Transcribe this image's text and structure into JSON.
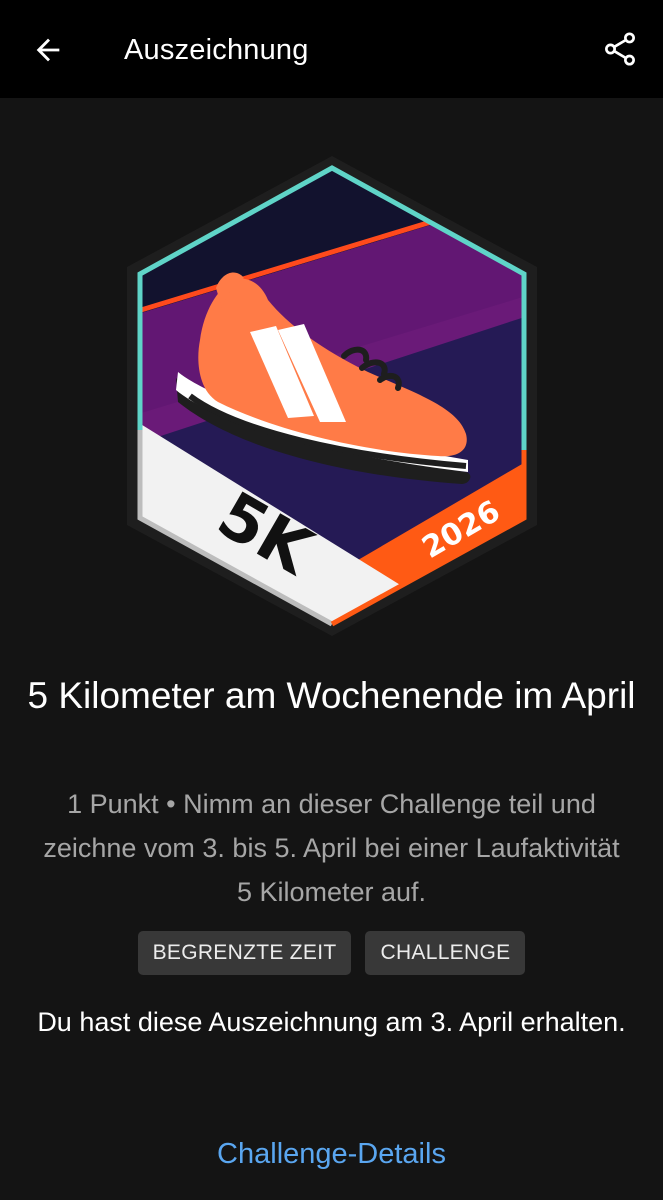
{
  "header": {
    "title": "Auszeichnung",
    "back_icon": "arrow-left-icon",
    "share_icon": "share-icon"
  },
  "badge": {
    "distance_label": "5K",
    "year_label": "2026",
    "icon": "running-shoe-icon",
    "colors": {
      "border": "#5fd4c8",
      "accent": "#ff5a1f",
      "shoe": "#ff7b47",
      "background_top": "#131230",
      "background_band": "#6a1a78"
    }
  },
  "award": {
    "title": "5 Kilometer am Wochenende im April",
    "description": "1 Punkt • Nimm an dieser Challenge teil und zeichne vom 3. bis 5. April bei einer Laufaktivität 5 Kilometer auf.",
    "tags": [
      "BEGRENZTE ZEIT",
      "CHALLENGE"
    ],
    "received_text": "Du hast diese Auszeichnung am 3. April erhalten.",
    "details_link": "Challenge-Details"
  }
}
